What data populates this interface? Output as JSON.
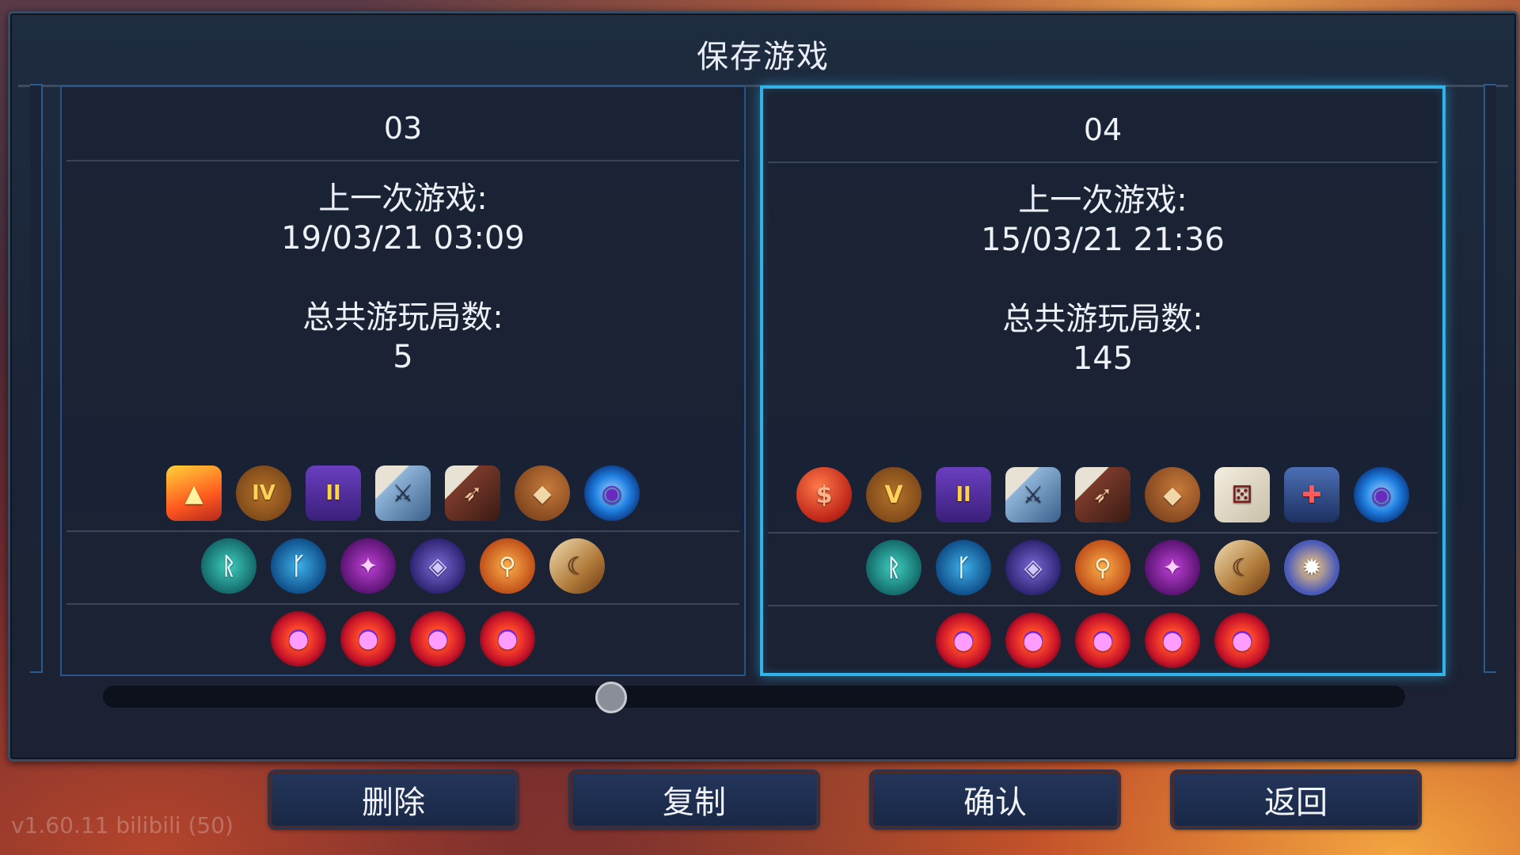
{
  "panel": {
    "title": "保存游戏"
  },
  "slots": [
    {
      "name": "03",
      "last_played_label": "上一次游戏:",
      "last_played": "19/03/21  03:09",
      "total_runs_label": "总共游玩局数:",
      "total_runs": "5",
      "selected": false,
      "row1": [
        "potion-flask-icon",
        "money-bag-iv-icon",
        "level-ii-up-icon",
        "dice-sword-icon",
        "dice-bow-icon",
        "dice-shield-icon",
        "blue-orb-icon"
      ],
      "row2": [
        "teal-rune-icon",
        "blue-rune-icon",
        "purple-flame-icon",
        "purple-gem-icon",
        "orange-rune-icon",
        "horn-icon"
      ],
      "row3": [
        "boss-cell-icon",
        "boss-cell-icon",
        "boss-cell-icon",
        "boss-cell-icon"
      ]
    },
    {
      "name": "04",
      "last_played_label": "上一次游戏:",
      "last_played": "15/03/21  21:36",
      "total_runs_label": "总共游玩局数:",
      "total_runs": "145",
      "selected": true,
      "row1": [
        "red-potion-icon",
        "money-bag-v-icon",
        "level-ii-up-icon",
        "dice-sword-icon",
        "dice-bow-icon",
        "dice-shield-icon",
        "dice-icon",
        "blue-banner-icon",
        "blue-orb-icon"
      ],
      "row2": [
        "teal-rune-icon",
        "blue-rune-icon",
        "purple-gem-icon",
        "orange-rune-icon",
        "purple-flame-icon",
        "horn-icon",
        "spider-rune-icon"
      ],
      "row3": [
        "boss-cell-icon",
        "boss-cell-icon",
        "boss-cell-icon",
        "boss-cell-icon",
        "boss-cell-icon"
      ]
    }
  ],
  "scrollbar": {
    "position": 0.39
  },
  "buttons": {
    "delete": "删除",
    "copy": "复制",
    "confirm": "确认",
    "back": "返回"
  },
  "version": "v1.60.11 bilibili (50)",
  "colors": {
    "selected_border": "#2fb3e8",
    "slot_border": "#28548a",
    "panel_bg": "#1c2638"
  }
}
